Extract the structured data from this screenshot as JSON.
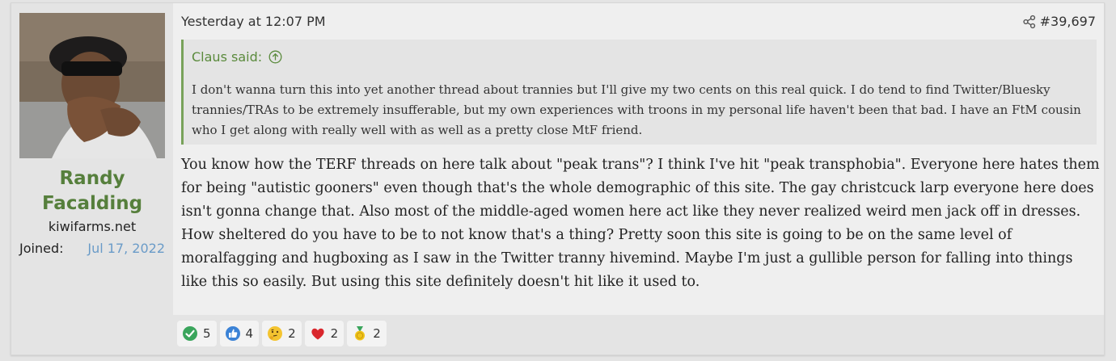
{
  "author": {
    "name": "Randy Facalding",
    "site": "kiwifarms.net",
    "joined_label": "Joined:",
    "joined_date": "Jul 17, 2022"
  },
  "post": {
    "timestamp": "Yesterday at 12:07 PM",
    "number": "#39,697",
    "quote": {
      "author": "Claus said:",
      "text": "I don't wanna turn this into yet another thread about trannies but I'll give my two cents on this real quick. I do tend to find Twitter/Bluesky trannies/TRAs to be extremely insufferable, but my own experiences with troons in my personal life haven't been that bad. I have an FtM cousin who I get along with really well with as well as a pretty close MtF friend."
    },
    "body": "You know how the TERF threads on here talk about \"peak trans\"? I think I've hit \"peak transphobia\". Everyone here hates them for being \"autistic gooners\" even though that's the whole demographic of this site. The gay christcuck larp everyone here does isn't gonna change that. Also most of the middle-aged women here act like they never realized weird men jack off in dresses. How sheltered do you have to be to not know that's a thing? Pretty soon this site is going to be on the same level of moralfagging and hugboxing as I saw in the Twitter tranny hivemind. Maybe I'm just a gullible person for falling into things like this so easily. But using this site definitely doesn't hit like it used to."
  },
  "reactions": [
    {
      "icon": "green-check-icon",
      "count": "5"
    },
    {
      "icon": "thumbs-up-icon",
      "count": "4"
    },
    {
      "icon": "thinking-face-icon",
      "count": "2"
    },
    {
      "icon": "heart-icon",
      "count": "2"
    },
    {
      "icon": "medal-icon",
      "count": "2"
    }
  ],
  "colors": {
    "username": "#567f3c",
    "quote_accent": "#78a25a",
    "link": "#6a9bc8"
  }
}
